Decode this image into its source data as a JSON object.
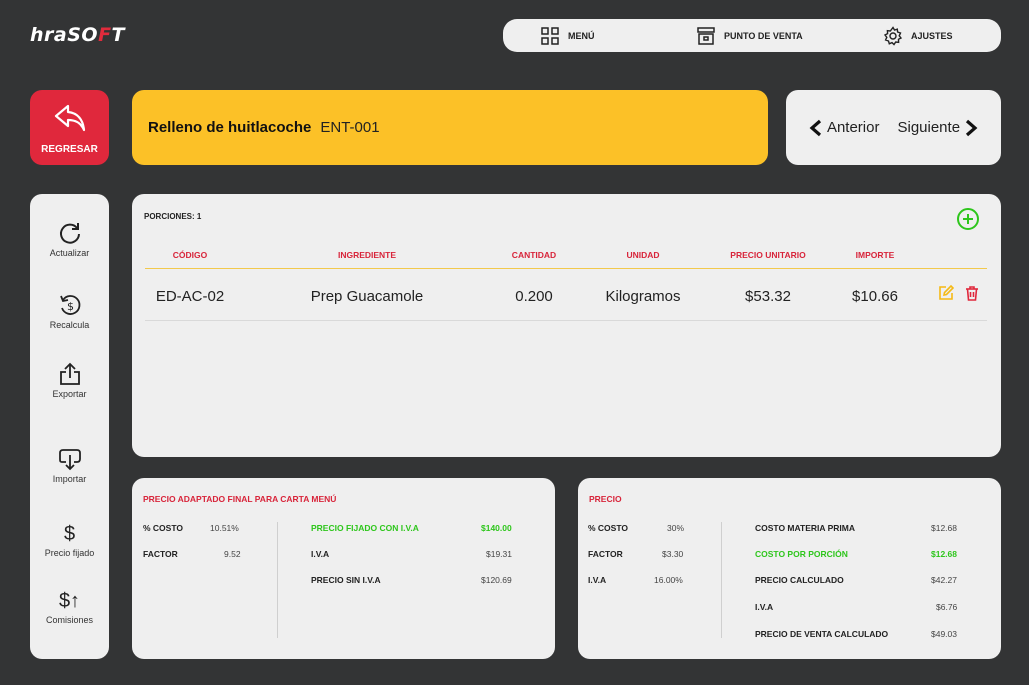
{
  "logo": {
    "pre": "hraSO",
    "accent": "F",
    "post": "T"
  },
  "topnav": {
    "menu": "MENÚ",
    "pos": "PUNTO DE VENTA",
    "settings": "AJUSTES"
  },
  "back": {
    "label": "REGRESAR"
  },
  "recipe": {
    "name": "Relleno de huitlacoche",
    "code": "ENT-001"
  },
  "pager": {
    "prev": "Anterior",
    "next": "Siguiente"
  },
  "sidebar": {
    "refresh": "Actualizar",
    "recalc": "Recalcula",
    "export": "Exportar",
    "import": "Importar",
    "fixed_price": "Precio fijado",
    "commissions": "Comisiones",
    "dollar": "$",
    "dollar_up": "$↑"
  },
  "table": {
    "portions": "PORCIONES: 1",
    "headers": [
      "CÓDIGO",
      "INGREDIENTE",
      "CANTIDAD",
      "UNIDAD",
      "PRECIO UNITARIO",
      "IMPORTE"
    ],
    "rows": [
      {
        "code": "ED-AC-02",
        "ingredient": "Prep Guacamole",
        "qty": "0.200",
        "unit": "Kilogramos",
        "unit_price": "$53.32",
        "amount": "$10.66"
      }
    ]
  },
  "final_price": {
    "title": "PRECIO ADAPTADO FINAL PARA CARTA MENÚ",
    "cost_pct_label": "% COSTO",
    "cost_pct": "10.51%",
    "factor_label": "FACTOR",
    "factor": "9.52",
    "fixed_label": "PRECIO FIJADO CON I.V.A",
    "fixed": "$140.00",
    "iva_label": "I.V.A",
    "iva": "$19.31",
    "no_iva_label": "PRECIO SIN I.V.A",
    "no_iva": "$120.69"
  },
  "price": {
    "title": "PRECIO",
    "cost_pct_label": "% COSTO",
    "cost_pct": "30%",
    "factor_label": "FACTOR",
    "factor": "$3.30",
    "iva_label": "I.V.A",
    "iva_pct": "16.00%",
    "raw_label": "COSTO MATERIA PRIMA",
    "raw": "$12.68",
    "portion_label": "COSTO POR PORCIÓN",
    "portion": "$12.68",
    "calc_label": "PRECIO CALCULADO",
    "calc": "$42.27",
    "iva2_label": "I.V.A",
    "iva2": "$6.76",
    "sale_label": "PRECIO DE VENTA CALCULADO",
    "sale": "$49.03"
  },
  "colors": {
    "accent_red": "#e0283c",
    "title_yellow": "#fcc127",
    "positive_green": "#2ec61c"
  }
}
